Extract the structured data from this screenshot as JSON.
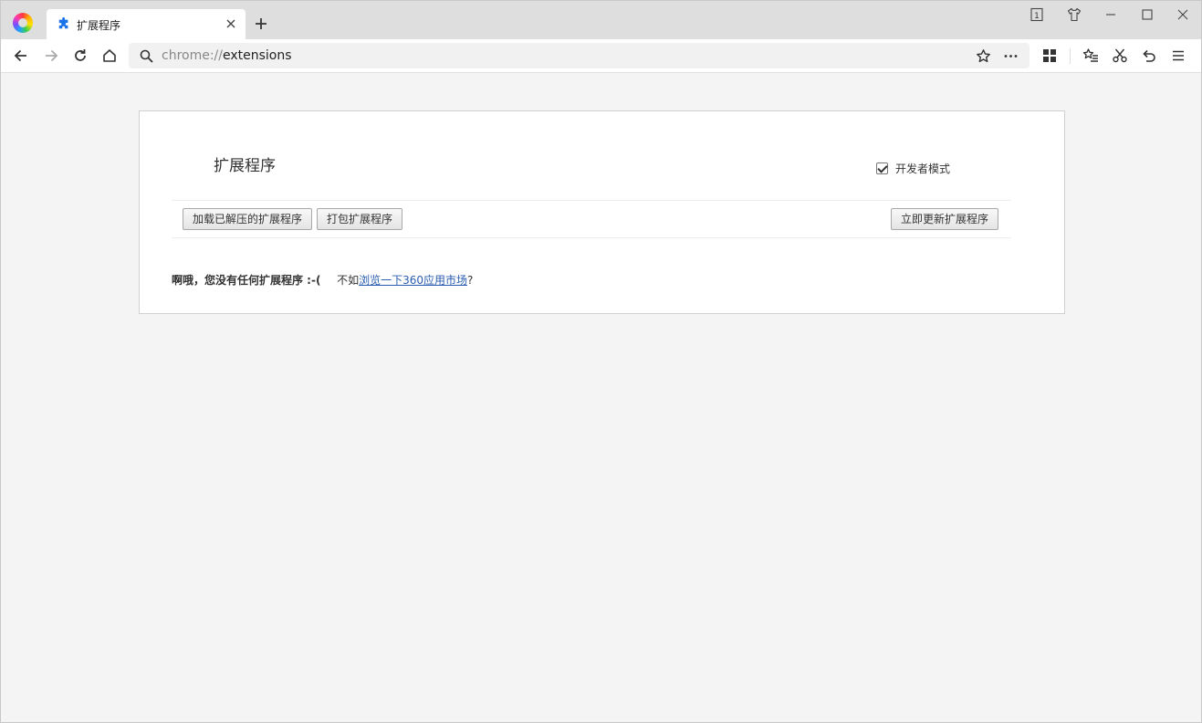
{
  "browser": {
    "tab": {
      "title": "扩展程序"
    },
    "window_controls": {
      "tab_count": "1"
    },
    "omnibox": {
      "scheme": "chrome://",
      "path": "extensions"
    }
  },
  "page": {
    "title": "扩展程序",
    "developer_mode": {
      "label": "开发者模式",
      "checked": true
    },
    "buttons": {
      "load_unpacked": "加载已解压的扩展程序",
      "pack": "打包扩展程序",
      "update_now": "立即更新扩展程序"
    },
    "empty_state": {
      "message": "啊哦，您没有任何扩展程序 :-(",
      "prefix": "不如",
      "link": "浏览一下360应用市场",
      "suffix": "?"
    }
  }
}
